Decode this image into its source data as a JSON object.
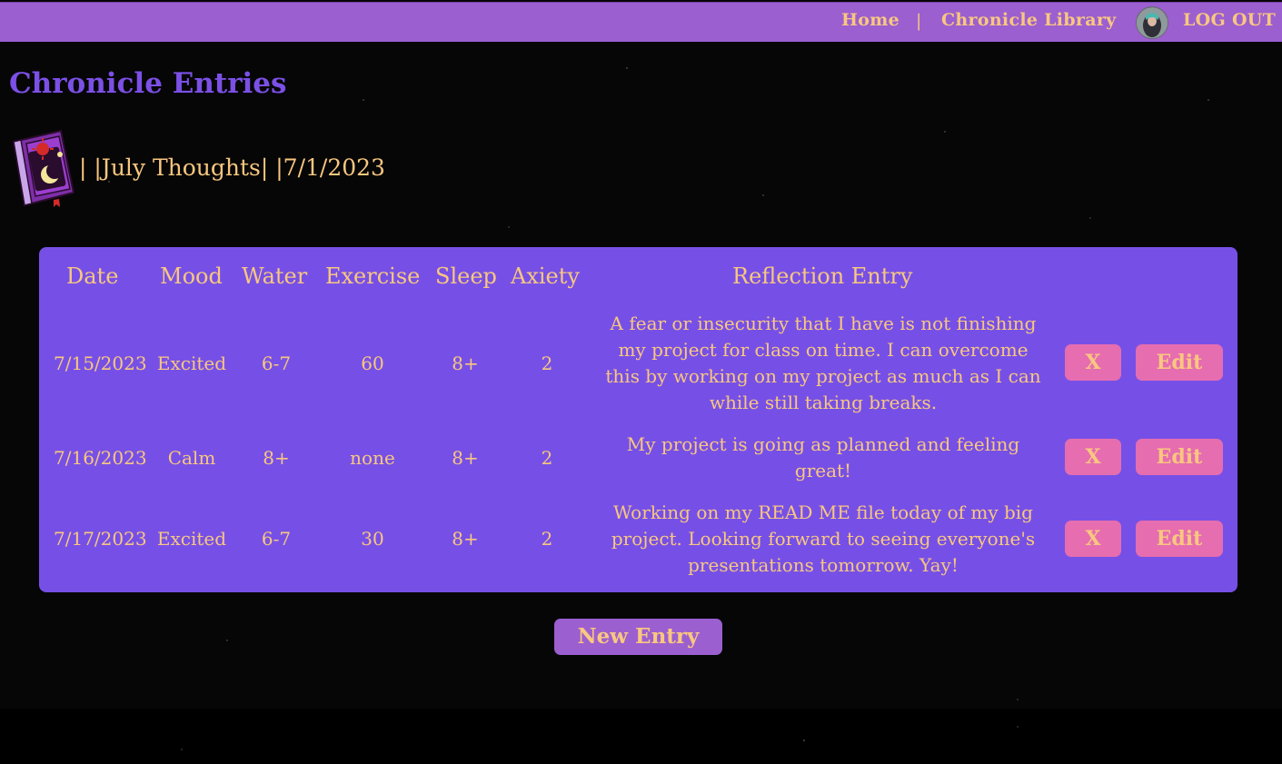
{
  "nav": {
    "home": "Home",
    "separator": "|",
    "library": "Chronicle Library",
    "logout": "LOG OUT"
  },
  "page": {
    "title": "Chronicle Entries",
    "chronicle_label": "| |July Thoughts| |7/1/2023"
  },
  "table": {
    "headers": [
      "Date",
      "Mood",
      "Water",
      "Exercise",
      "Sleep",
      "Axiety",
      "Reflection Entry"
    ],
    "rows": [
      {
        "date": "7/15/2023",
        "mood": "Excited",
        "water": "6-7",
        "exercise": "60",
        "sleep": "8+",
        "anxiety": "2",
        "reflection": "A fear or insecurity that I have is not finishing my project for class on time. I can overcome this by working on my project as much as I can while still taking breaks."
      },
      {
        "date": "7/16/2023",
        "mood": "Calm",
        "water": "8+",
        "exercise": "none",
        "sleep": "8+",
        "anxiety": "2",
        "reflection": "My project is going as planned and feeling great!"
      },
      {
        "date": "7/17/2023",
        "mood": "Excited",
        "water": "6-7",
        "exercise": "30",
        "sleep": "8+",
        "anxiety": "2",
        "reflection": "Working on my READ ME file today of my big project. Looking forward to seeing everyone's presentations tomorrow. Yay!"
      }
    ],
    "delete_label": "X",
    "edit_label": "Edit"
  },
  "new_entry_label": "New Entry",
  "icons": {
    "avatar": "user-avatar",
    "book": "chronicle-book-icon"
  },
  "colors": {
    "nav_bg": "#9b5fd0",
    "accent_text": "#f9c77f",
    "title": "#7b50e6",
    "card_bg": "#7650e6",
    "button": "#e66db0"
  }
}
